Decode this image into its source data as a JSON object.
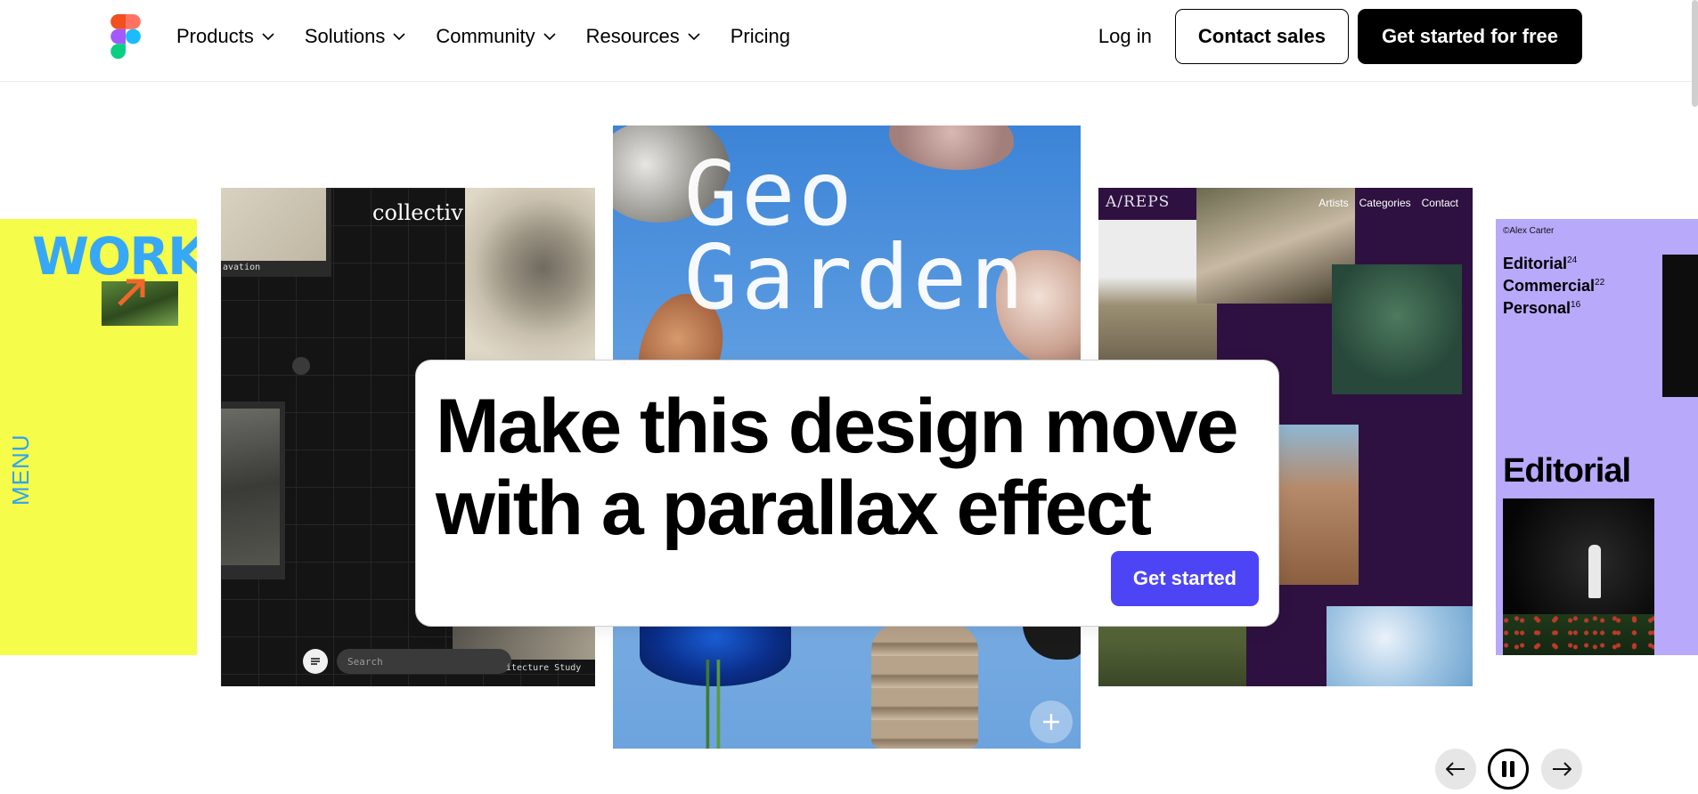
{
  "nav": {
    "items": [
      {
        "label": "Products",
        "has_menu": true
      },
      {
        "label": "Solutions",
        "has_menu": true
      },
      {
        "label": "Community",
        "has_menu": true
      },
      {
        "label": "Resources",
        "has_menu": true
      },
      {
        "label": "Pricing",
        "has_menu": false
      }
    ],
    "login": "Log in",
    "contact_sales": "Contact sales",
    "get_started_free": "Get started for free"
  },
  "hero": {
    "headline_line1": "Make this design move",
    "headline_line2": "with a parallax effect",
    "cta": "Get started",
    "cta_color": "#4d45f5"
  },
  "cards": {
    "works": {
      "menu": "MENU",
      "title": "WORKS",
      "bg": "#f5fc49"
    },
    "collectiv": {
      "brand": "collectiv",
      "caption_top": "avation",
      "search_placeholder": "Search",
      "caption_bottom": "itecture Study"
    },
    "geo": {
      "line1": "Geo",
      "line2": "Garden"
    },
    "areps": {
      "brand": "A/REPS",
      "links": [
        "Artists",
        "Categories",
        "Contact"
      ]
    },
    "editorial": {
      "credit": "©Alex Carter",
      "items": [
        {
          "label": "Editorial",
          "count": "24"
        },
        {
          "label": "Commercial",
          "count": "22"
        },
        {
          "label": "Personal",
          "count": "16"
        }
      ],
      "heading": "Editorial",
      "bg": "#b8a9fb"
    }
  },
  "carousel": {
    "icons": [
      "arrow-left-icon",
      "pause-icon",
      "arrow-right-icon"
    ],
    "state": "playing"
  }
}
